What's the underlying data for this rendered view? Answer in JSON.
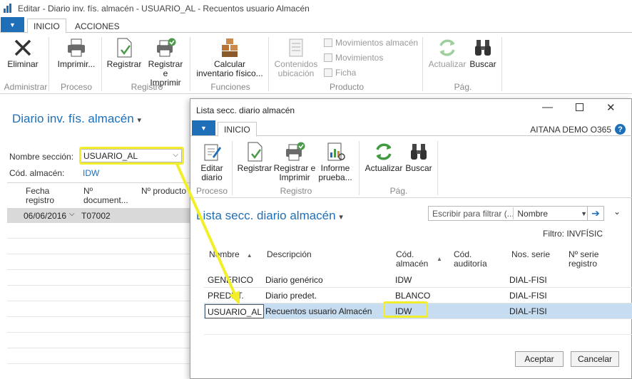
{
  "window": {
    "title": "Editar - Diario inv. fís. almacén - USUARIO_AL - Recuentos usuario Almacén"
  },
  "ribbon_tabs": [
    "INICIO",
    "ACCIONES"
  ],
  "ribbon": {
    "eliminar": "Eliminar",
    "imprimir": "Imprimir...",
    "registrar": "Registrar",
    "registrar_imprimir_1": "Registrar e",
    "registrar_imprimir_2": "Imprimir",
    "calcular_1": "Calcular",
    "calcular_2": "inventario físico...",
    "contenidos_1": "Contenidos",
    "contenidos_2": "ubicación",
    "mov_almacen": "Movimientos almacén",
    "movimientos": "Movimientos",
    "ficha": "Ficha",
    "actualizar": "Actualizar",
    "buscar": "Buscar",
    "groups": [
      "Administrar",
      "Proceso",
      "Registro",
      "Funciones",
      "Producto",
      "Pág."
    ]
  },
  "page": {
    "title": "Diario inv. fís. almacén",
    "seccion_label": "Nombre sección:",
    "seccion_value": "USUARIO_AL",
    "almacen_label": "Cód. almacén:",
    "almacen_value": "IDW",
    "col_fecha_1": "Fecha",
    "col_fecha_2": "registro",
    "col_doc_1": "Nº",
    "col_doc_2": "document...",
    "col_producto": "Nº producto",
    "row_fecha": "06/06/2016",
    "row_doc": "T07002"
  },
  "modal": {
    "title": "Lista secc. diario almacén",
    "tab": "INICIO",
    "company": "AITANA DEMO O365",
    "help": "?",
    "btn_editar_1": "Editar",
    "btn_editar_2": "diario",
    "btn_registrar": "Registrar",
    "btn_reg_imp_1": "Registrar e",
    "btn_reg_imp_2": "Imprimir",
    "btn_informe_1": "Informe",
    "btn_informe_2": "prueba...",
    "btn_actualizar": "Actualizar",
    "btn_buscar": "Buscar",
    "groups": [
      "Proceso",
      "Registro",
      "Pág."
    ],
    "list_title": "Lista secc. diario almacén",
    "filter_placeholder": "Escribir para filtrar (...",
    "filter_field": "Nombre",
    "filter_info": "Filtro: INVFÍSIC",
    "columns": {
      "nombre": "Nombre",
      "descripcion": "Descripción",
      "cod_almacen_1": "Cód.",
      "cod_almacen_2": "almacén",
      "cod_auditoria_1": "Cód.",
      "cod_auditoria_2": "auditoría",
      "nos_serie": "Nos. serie",
      "serie_reg_1": "Nº serie",
      "serie_reg_2": "registro"
    },
    "rows": [
      {
        "nombre": "GENERICO",
        "descripcion": "Diario genérico",
        "almacen": "IDW",
        "serie": "DIAL-FISI"
      },
      {
        "nombre": "PREDET.",
        "descripcion": "Diario predet.",
        "almacen": "BLANCO",
        "serie": "DIAL-FISI"
      },
      {
        "nombre": "USUARIO_AL",
        "descripcion": "Recuentos usuario Almacén",
        "almacen": "IDW",
        "serie": "DIAL-FISI"
      }
    ],
    "btn_aceptar": "Aceptar",
    "btn_cancelar": "Cancelar"
  },
  "colors": {
    "accent": "#1e6fb8",
    "highlight": "#f2ef2a",
    "selection": "#c6dcf0"
  }
}
